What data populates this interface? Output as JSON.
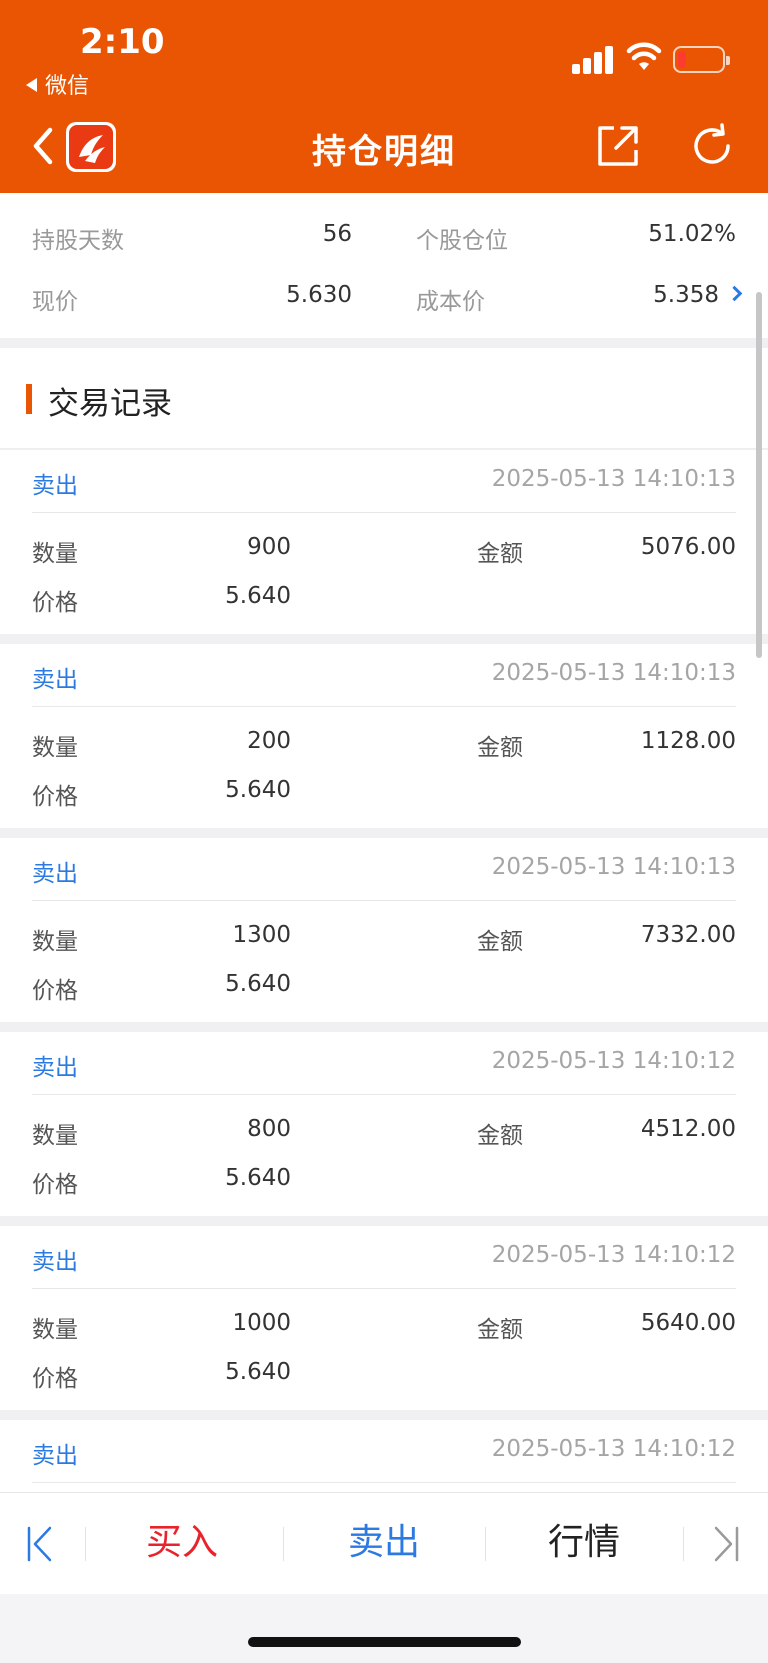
{
  "status_bar": {
    "time": "2:10",
    "back_app": "微信"
  },
  "header": {
    "title": "持仓明细"
  },
  "summary": [
    {
      "label": "持股天数",
      "value": "56"
    },
    {
      "label": "个股仓位",
      "value": "51.02%"
    },
    {
      "label": "现价",
      "value": "5.630"
    },
    {
      "label": "成本价",
      "value": "5.358"
    }
  ],
  "section": {
    "title": "交易记录"
  },
  "labels": {
    "quantity": "数量",
    "amount": "金额",
    "price": "价格"
  },
  "records": [
    {
      "type": "卖出",
      "time": "2025-05-13 14:10:13",
      "quantity": "900",
      "amount": "5076.00",
      "price": "5.640"
    },
    {
      "type": "卖出",
      "time": "2025-05-13 14:10:13",
      "quantity": "200",
      "amount": "1128.00",
      "price": "5.640"
    },
    {
      "type": "卖出",
      "time": "2025-05-13 14:10:13",
      "quantity": "1300",
      "amount": "7332.00",
      "price": "5.640"
    },
    {
      "type": "卖出",
      "time": "2025-05-13 14:10:12",
      "quantity": "800",
      "amount": "4512.00",
      "price": "5.640"
    },
    {
      "type": "卖出",
      "time": "2025-05-13 14:10:12",
      "quantity": "1000",
      "amount": "5640.00",
      "price": "5.640"
    },
    {
      "type": "卖出",
      "time": "2025-05-13 14:10:12"
    }
  ],
  "toolbar": {
    "buy": "买入",
    "sell": "卖出",
    "quote": "行情"
  },
  "colors": {
    "brand": "#ea5504",
    "buy": "#e8232b",
    "sell": "#2a7ae2",
    "link": "#2a7ae2"
  }
}
